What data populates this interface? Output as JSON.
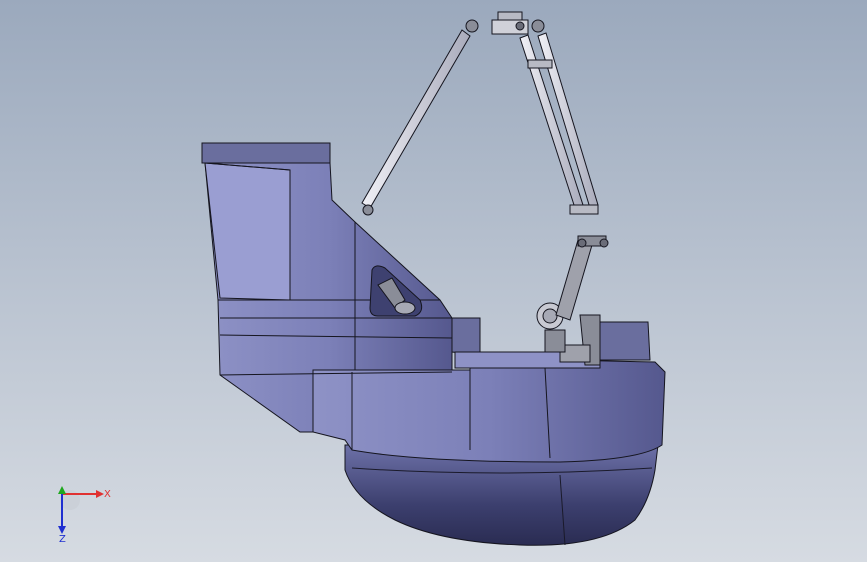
{
  "viewport": {
    "background_top": "#9ba9bd",
    "background_bottom": "#d6dbe2"
  },
  "model": {
    "body_color": "#7c80b8",
    "edge_color": "#15151f",
    "arm_color": "#d8d9e3"
  },
  "triad": {
    "x_label": "X",
    "z_label": "Z",
    "x_color": "#e03131",
    "y_color": "#1ea81e",
    "z_color": "#1f2fd0"
  }
}
